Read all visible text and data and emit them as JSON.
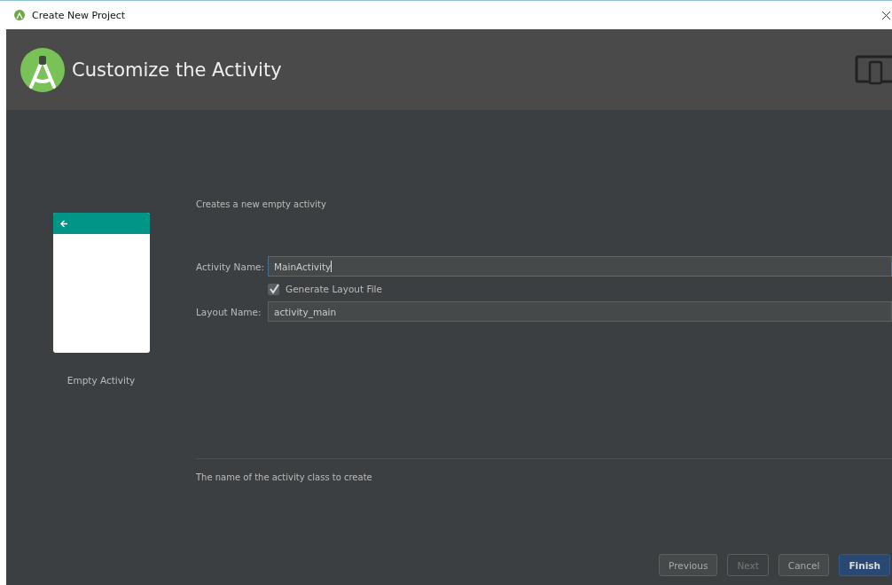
{
  "window": {
    "title": "Create New Project"
  },
  "header": {
    "title": "Customize the Activity"
  },
  "template": {
    "name": "Empty Activity"
  },
  "description": "Creates a new empty activity",
  "fields": [
    {
      "label": "Activity Name:",
      "value": "MainActivity",
      "focused": true
    },
    {
      "label": "Layout Name:",
      "value": "activity_main",
      "focused": false
    }
  ],
  "generate_layout": {
    "label": "Generate Layout File",
    "checked": true
  },
  "help_text": "The name of the activity class to create",
  "buttons": [
    {
      "label": "Previous",
      "kind": "default",
      "disabled": false
    },
    {
      "label": "Next",
      "kind": "default",
      "disabled": true
    },
    {
      "label": "Cancel",
      "kind": "default",
      "disabled": false
    },
    {
      "label": "Finish",
      "kind": "primary",
      "disabled": false
    }
  ]
}
